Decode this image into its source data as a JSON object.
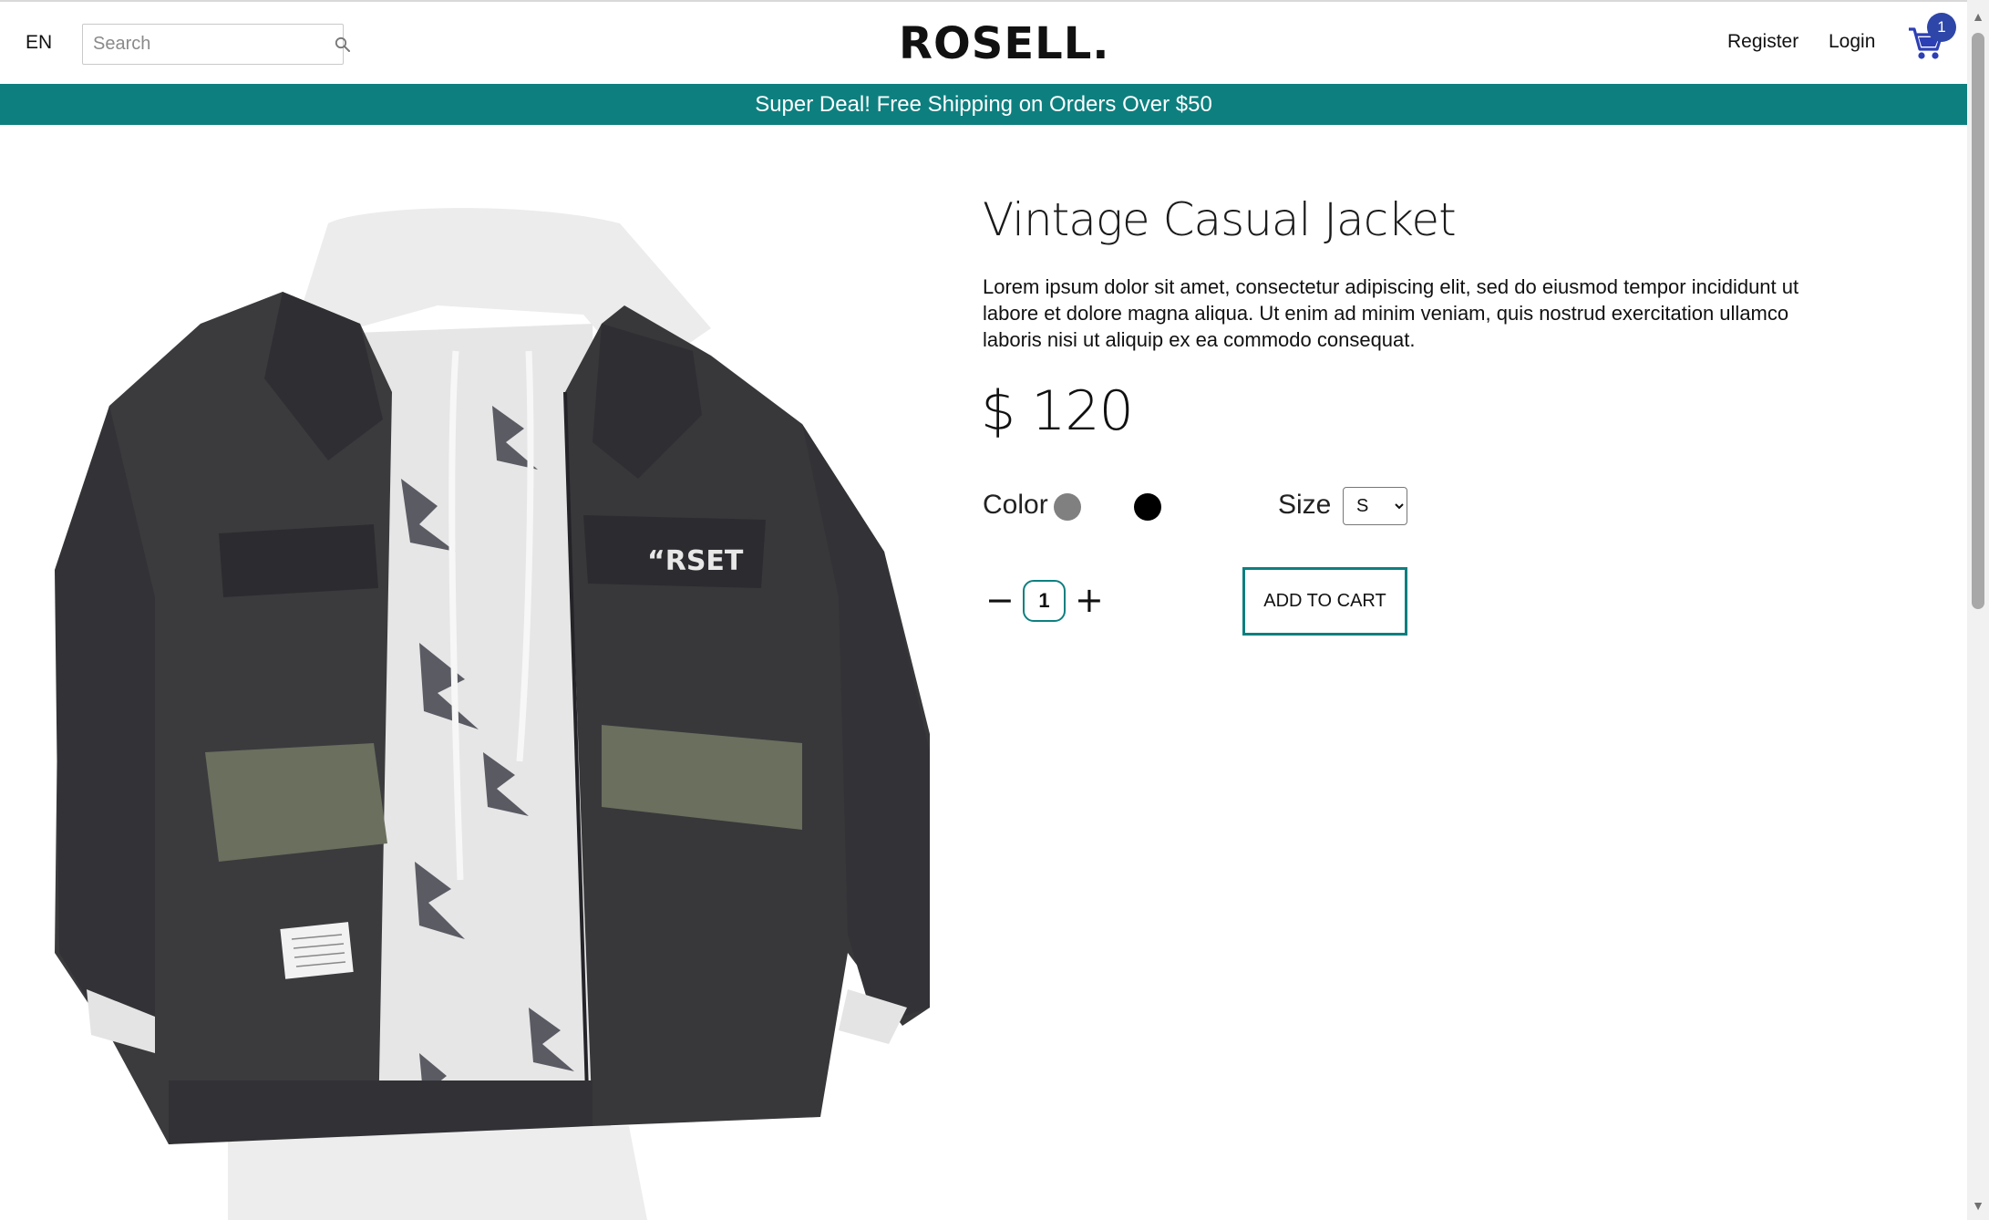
{
  "header": {
    "language": "EN",
    "search": {
      "placeholder": "Search",
      "value": ""
    },
    "logo": "ROSELL.",
    "register": "Register",
    "login": "Login",
    "cart_count": "1"
  },
  "announcement": "Super Deal! Free Shipping on Orders Over $50",
  "product": {
    "title": "Vintage Casual Jacket",
    "description": "Lorem ipsum dolor sit amet, consectetur adipiscing elit, sed do eiusmod tempor incididunt ut labore et dolore magna aliqua. Ut enim ad minim veniam, quis nostrud exercitation ullamco laboris nisi ut aliquip ex ea commodo consequat.",
    "price": "$ 120",
    "color_label": "Color",
    "colors": [
      "#808080",
      "#000000"
    ],
    "size_label": "Size",
    "size_selected": "S",
    "quantity": "1",
    "quantity_decrease": "−",
    "quantity_increase": "+",
    "add_to_cart": "ADD TO CART"
  },
  "colors": {
    "accent": "#0e7f7f",
    "badge": "#2d46a8",
    "cart_icon": "#2d3fb5"
  },
  "icons": [
    "search-icon",
    "cart-icon",
    "jacket-image",
    "scroll-up-arrow",
    "scroll-down-arrow"
  ]
}
